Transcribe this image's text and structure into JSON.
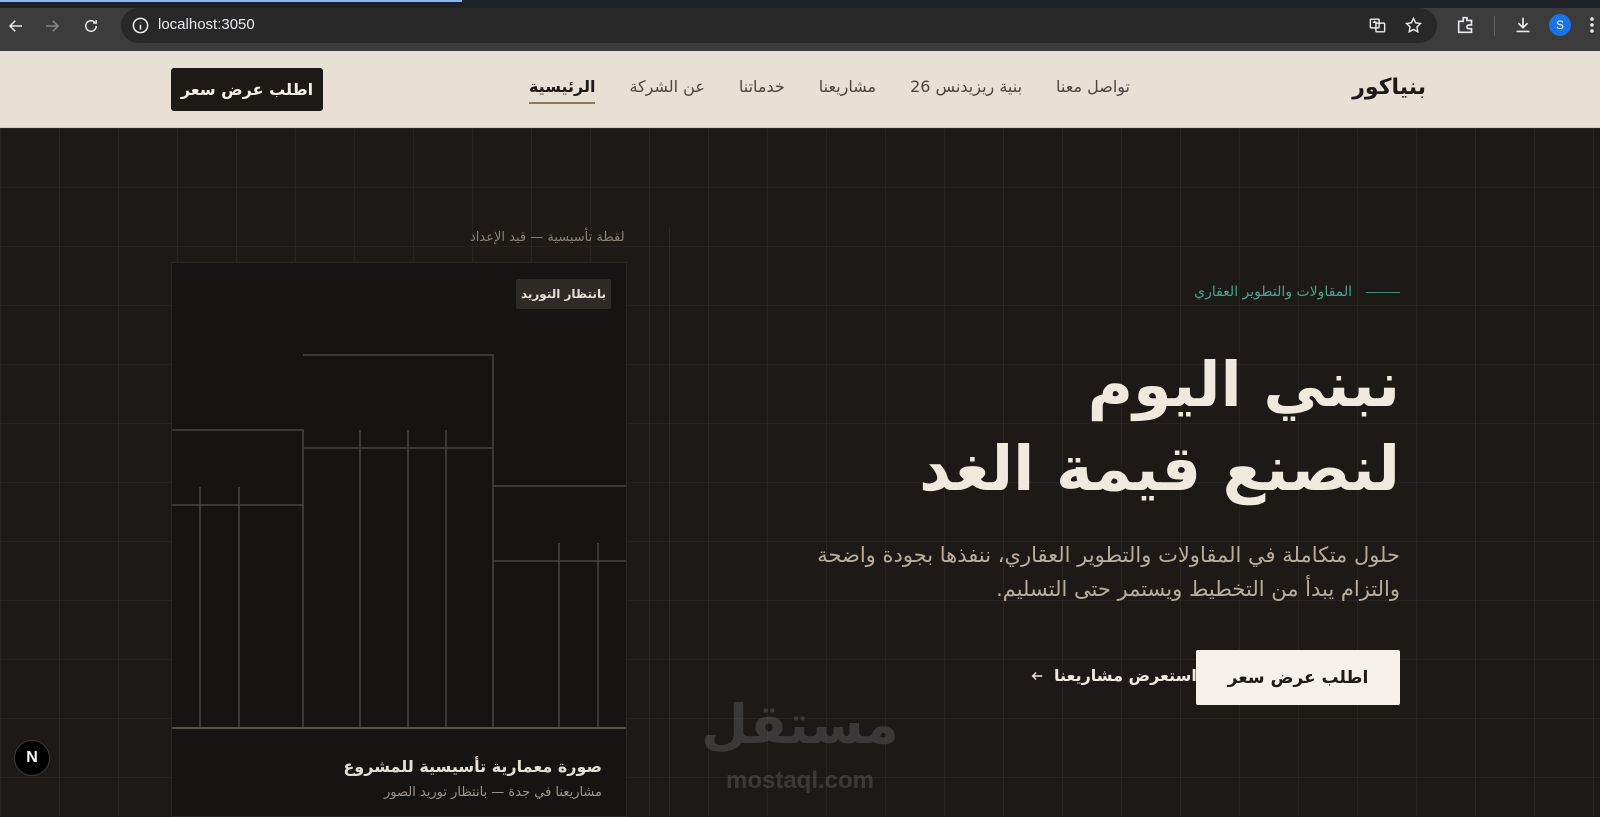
{
  "browser": {
    "url": "localhost:3050",
    "profile_initial": "S",
    "icons": [
      "back-icon",
      "forward-icon",
      "reload-icon",
      "info-icon",
      "translate-icon",
      "star-icon",
      "extensions-icon",
      "download-icon",
      "profile-avatar",
      "menu-icon"
    ]
  },
  "header": {
    "brand": "بنياكور",
    "nav": [
      {
        "label": "الرئيسية",
        "active": true
      },
      {
        "label": "عن الشركة",
        "active": false
      },
      {
        "label": "خدماتنا",
        "active": false
      },
      {
        "label": "مشاريعنا",
        "active": false
      },
      {
        "label": "بنية ريزيدنس 26",
        "active": false
      },
      {
        "label": "تواصل معنا",
        "active": false
      }
    ],
    "cta_label": "اطلب عرض سعر"
  },
  "hero": {
    "eyebrow": "المقاولات والتطوير العقاري",
    "title_line1": "نبني اليوم",
    "title_line2": "لنصنع قيمة الغد",
    "description": "حلول متكاملة في المقاولات والتطوير العقاري، ننفذها بجودة واضحة والتزام يبدأ من التخطيط ويستمر حتى التسليم.",
    "primary_cta": "اطلب عرض سعر",
    "secondary_cta": "استعرض مشاريعنا"
  },
  "visual": {
    "caption_top": "لقطة تأسيسية — قيد الإعداد",
    "badge": "بانتظار التوريد",
    "title": "صورة معمارية تأسيسية للمشروع",
    "subtitle": "مشاريعنا في جدة — بانتظار توريد الصور"
  },
  "watermark": {
    "arabic": "مستقل",
    "latin": "mostaql.com"
  },
  "next_badge": "N",
  "colors": {
    "header_bg": "#e8e0d4",
    "hero_bg": "#1c1917",
    "accent_green": "#4aa38e",
    "cream": "#f0e9dd"
  }
}
